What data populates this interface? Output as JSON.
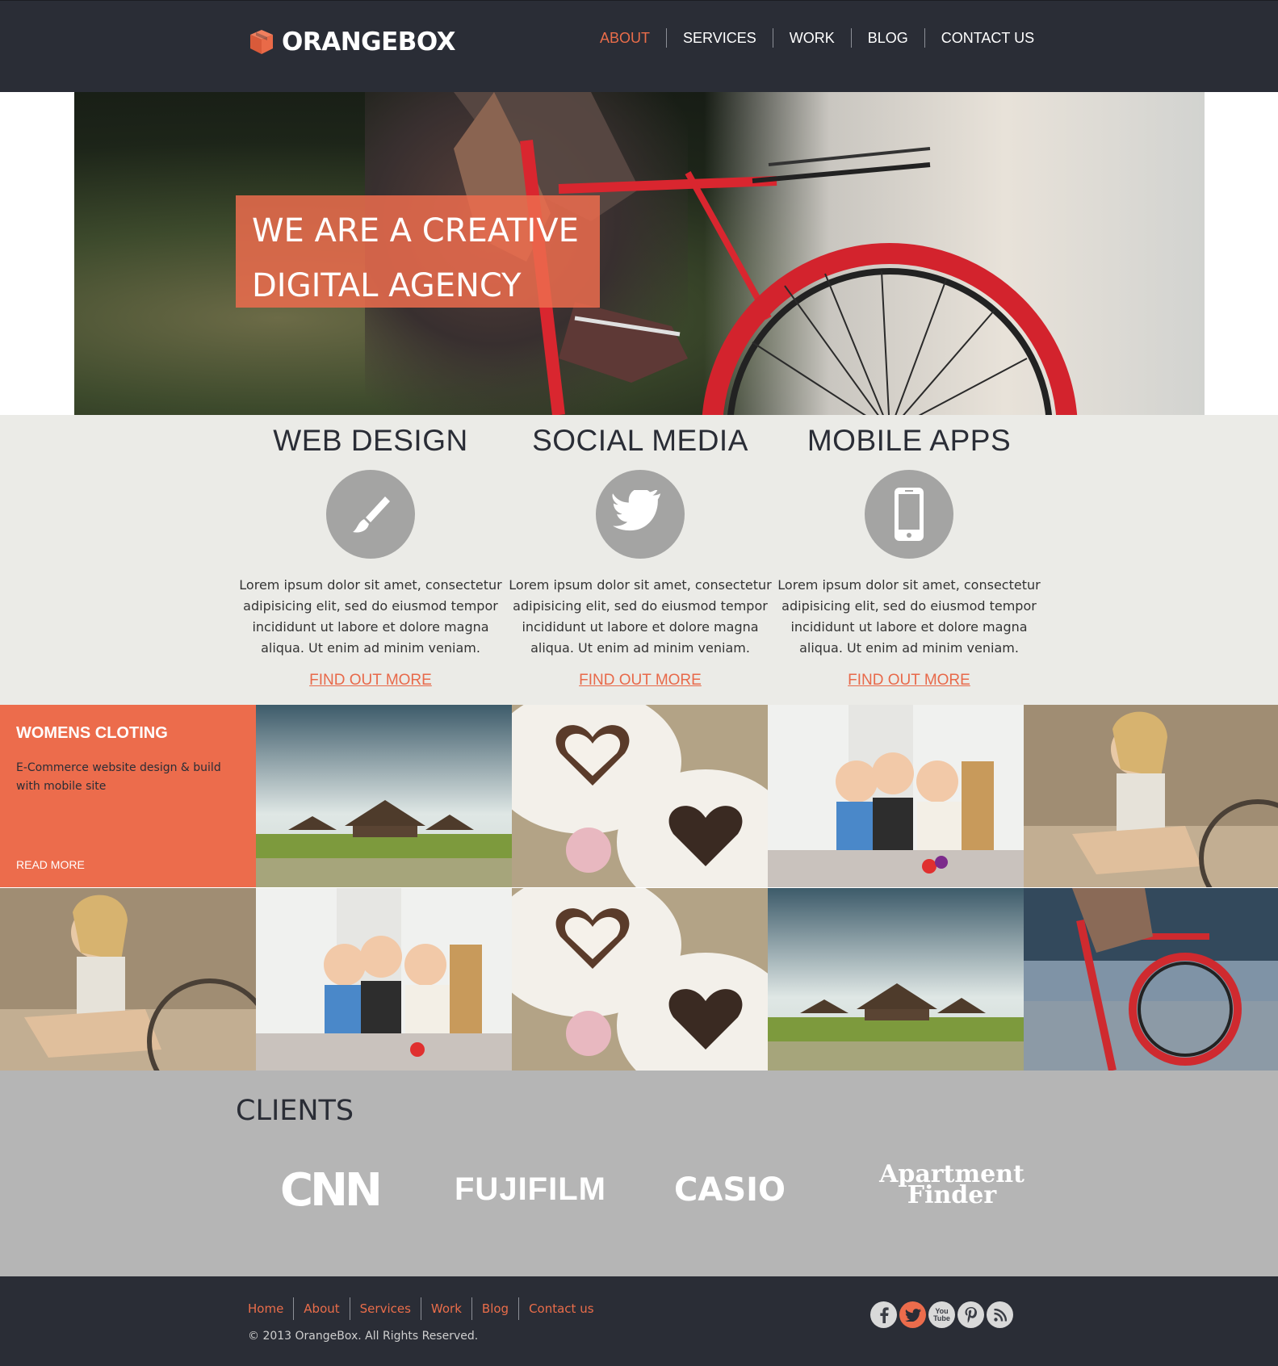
{
  "header": {
    "logo_text": "ORANGEBOX",
    "nav": [
      {
        "label": "ABOUT",
        "active": true
      },
      {
        "label": "SERVICES",
        "active": false
      },
      {
        "label": "WORK",
        "active": false
      },
      {
        "label": "BLOG",
        "active": false
      },
      {
        "label": "CONTACT US",
        "active": false
      }
    ]
  },
  "hero": {
    "line1": "WE ARE A CREATIVE",
    "line2": "DIGITAL AGENCY"
  },
  "services": [
    {
      "title": "WEB DESIGN",
      "icon": "paintbrush-icon",
      "text": "Lorem ipsum dolor sit amet, consectetur adipisicing elit, sed do eiusmod tempor incididunt ut labore et dolore magna aliqua. Ut enim ad minim veniam.",
      "link": "FIND OUT MORE"
    },
    {
      "title": "SOCIAL MEDIA",
      "icon": "twitter-bird-icon",
      "text": "Lorem ipsum dolor sit amet, consectetur adipisicing elit, sed do eiusmod tempor incididunt ut labore et dolore magna aliqua. Ut enim ad minim veniam.",
      "link": "FIND OUT MORE"
    },
    {
      "title": "MOBILE APPS",
      "icon": "smartphone-icon",
      "text": "Lorem ipsum dolor sit amet, consectetur adipisicing elit, sed do eiusmod tempor incididunt ut labore et dolore magna aliqua. Ut enim ad minim veniam.",
      "link": "FIND OUT MORE"
    }
  ],
  "gallery": {
    "promo": {
      "title": "WOMENS CLOTING",
      "desc": "E-Commerce website design & build with mobile site",
      "link": "READ MORE"
    }
  },
  "clients": {
    "title": "CLIENTS",
    "logos": [
      "CNN",
      "FUJIFILM",
      "CASIO",
      "Apartment",
      "Finder"
    ]
  },
  "footer": {
    "links": [
      "Home",
      "About",
      "Services",
      "Work",
      "Blog",
      "Contact us"
    ],
    "copyright": "© 2013 OrangeBox. All Rights Reserved.",
    "social": [
      {
        "name": "facebook-icon",
        "glyph": "f"
      },
      {
        "name": "twitter-icon",
        "glyph": "t"
      },
      {
        "name": "youtube-icon",
        "glyph": "You Tube"
      },
      {
        "name": "pinterest-icon",
        "glyph": "P"
      },
      {
        "name": "rss-icon",
        "glyph": "rss"
      }
    ]
  },
  "colors": {
    "accent": "#ec6c4c",
    "header_bg": "#2a2d36",
    "services_bg": "#ebebe7",
    "clients_bg": "#b5b5b5"
  }
}
